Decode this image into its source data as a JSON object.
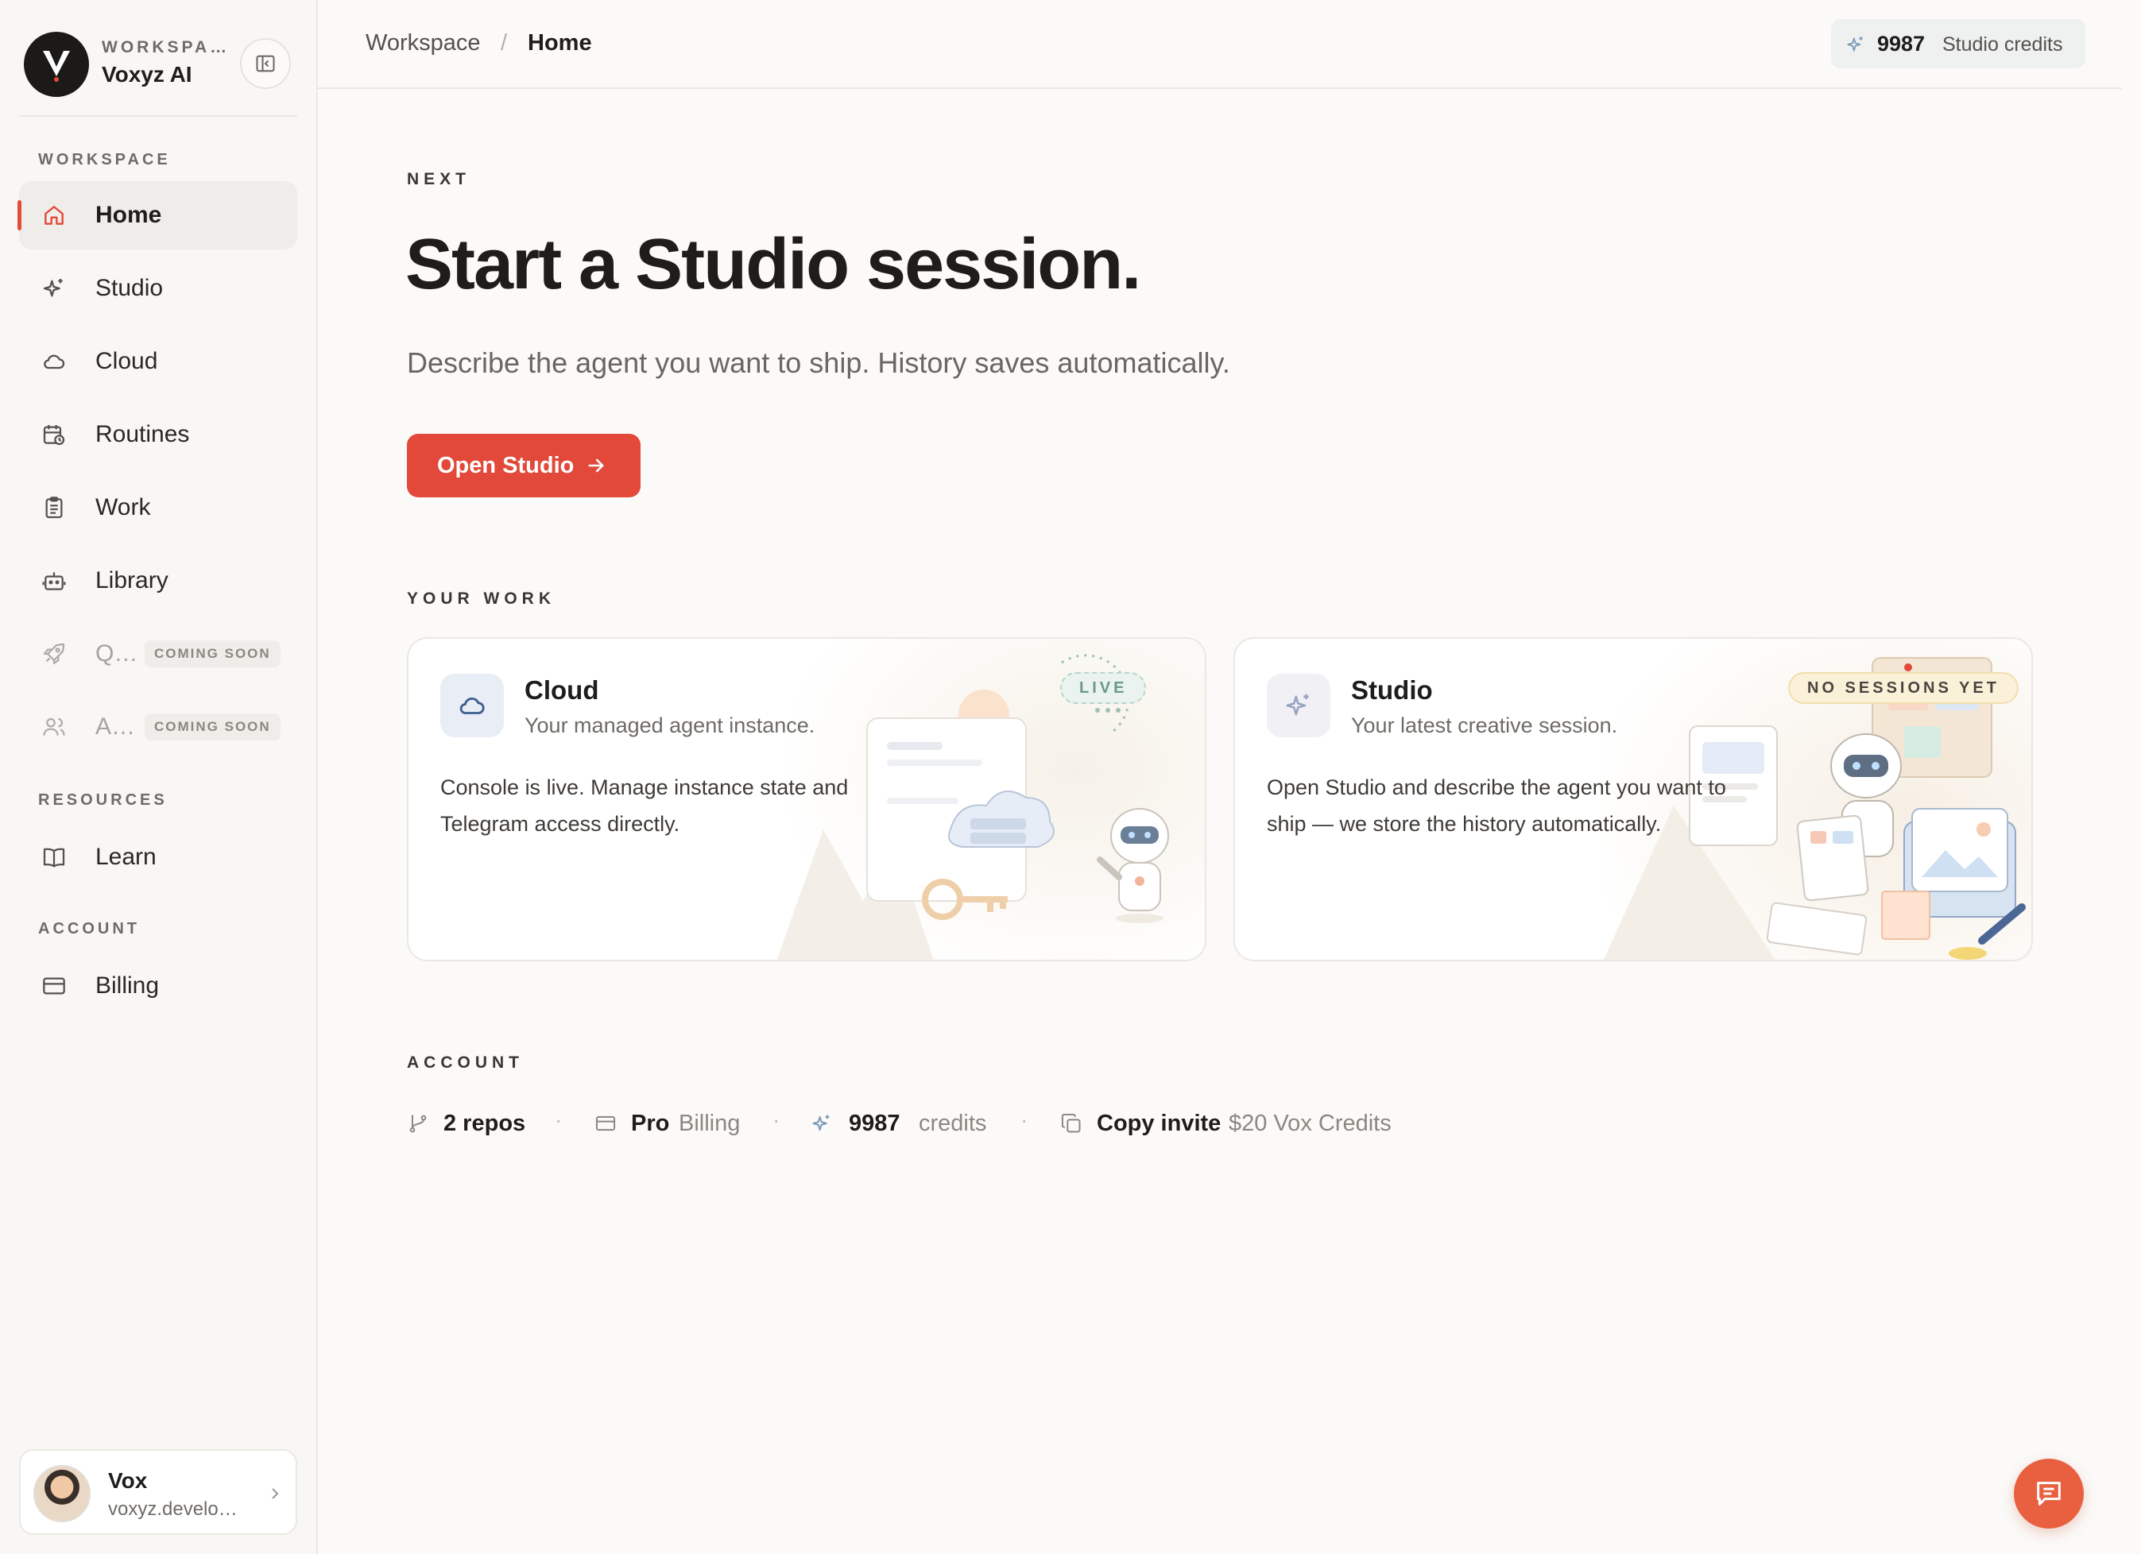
{
  "workspace": {
    "kicker": "WORKSPA…",
    "name": "Voxyz AI"
  },
  "sidebar": {
    "sections": {
      "workspace": "WORKSPACE",
      "resources": "RESOURCES",
      "account": "ACCOUNT"
    },
    "items": [
      {
        "label": "Home",
        "icon": "home-icon",
        "active": true
      },
      {
        "label": "Studio",
        "icon": "sparkle-icon"
      },
      {
        "label": "Cloud",
        "icon": "cloud-icon"
      },
      {
        "label": "Routines",
        "icon": "calendar-clock-icon"
      },
      {
        "label": "Work",
        "icon": "clipboard-icon"
      },
      {
        "label": "Library",
        "icon": "bot-icon"
      },
      {
        "label": "Q…",
        "icon": "rocket-icon",
        "badge": "COMING SOON"
      },
      {
        "label": "A…",
        "icon": "users-icon",
        "badge": "COMING SOON"
      },
      {
        "label": "Learn",
        "icon": "book-icon"
      },
      {
        "label": "Billing",
        "icon": "credit-card-icon"
      }
    ],
    "user": {
      "name": "Vox",
      "email": "voxyz.develo…"
    }
  },
  "topbar": {
    "breadcrumb": [
      "Workspace",
      "/",
      "Home"
    ],
    "credits_value": "9987",
    "credits_label": "Studio credits"
  },
  "hero": {
    "kicker": "NEXT",
    "title": "Start a Studio session.",
    "subtitle": "Describe the agent you want to ship. History saves automatically.",
    "cta": "Open Studio"
  },
  "your_work": {
    "label": "YOUR WORK",
    "cards": [
      {
        "title": "Cloud",
        "subtitle": "Your managed agent instance.",
        "body": "Console is live. Manage instance state and Telegram access directly.",
        "badge": "LIVE",
        "icon": "cloud-icon"
      },
      {
        "title": "Studio",
        "subtitle": "Your latest creative session.",
        "body": "Open Studio and describe the agent you want to ship — we store the history automatically.",
        "badge": "NO SESSIONS YET",
        "icon": "sparkle-icon"
      }
    ]
  },
  "account": {
    "label": "ACCOUNT",
    "repos": "2 repos",
    "plan": "Pro",
    "plan_meta": "Billing",
    "credits": "9987",
    "credits_meta": "credits",
    "invite": "Copy invite",
    "invite_meta": "$20 Vox Credits",
    "separator": "·"
  },
  "colors": {
    "accent": "#e3493a",
    "fab": "#e8603f",
    "live": "#6a9a86"
  }
}
